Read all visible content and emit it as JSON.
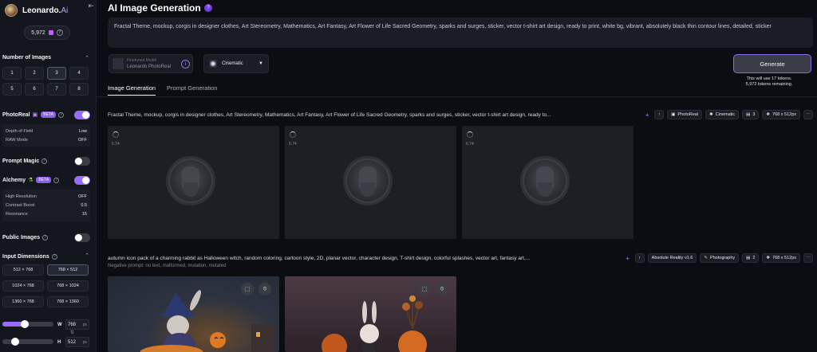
{
  "brand": {
    "name": "Leonardo.",
    "suffix": "Ai",
    "collapse_icon": "collapse-sidebar-icon"
  },
  "tokens": {
    "count": "5,972"
  },
  "sidebar": {
    "num_images_title": "Number of Images",
    "num_images": [
      "1",
      "2",
      "3",
      "4",
      "5",
      "6",
      "7",
      "8"
    ],
    "num_images_selected": "3",
    "photoreal": {
      "label": "PhotoReal",
      "badge": "BETA",
      "on": true,
      "rows": [
        {
          "k": "Depth of Field",
          "v": "Low"
        },
        {
          "k": "RAW Mode",
          "v": "OFF"
        }
      ]
    },
    "prompt_magic": {
      "label": "Prompt Magic",
      "on": false
    },
    "alchemy": {
      "label": "Alchemy",
      "badge": "BETA",
      "on": true,
      "rows": [
        {
          "k": "High Resolution",
          "v": "OFF"
        },
        {
          "k": "Contrast Boost",
          "v": "0.5"
        },
        {
          "k": "Resonance",
          "v": "15"
        }
      ]
    },
    "public_images": {
      "label": "Public Images",
      "on": false
    },
    "input_dimensions": {
      "title": "Input Dimensions",
      "options": [
        "512 × 768",
        "768 × 512",
        "1024 × 768",
        "768 × 1024",
        "1360 × 768",
        "768 × 1360"
      ],
      "selected": "768 × 512"
    },
    "width": {
      "label": "W",
      "value": "768",
      "unit": "px",
      "fraction": 0.42
    },
    "height": {
      "label": "H",
      "value": "512",
      "unit": "px",
      "fraction": 0.2
    }
  },
  "main": {
    "title": "AI Image Generation",
    "prompt": "Fractal Theme, mockup, corgis in designer clothes, Art Stereometry, Mathematics, Art Fantasy, Art Flower of Life Sacred Geometry, sparks and surges, sticker, vector t-shirt art design, ready to print, white bg, vibrant, absolutely black thin contour lines, detailed, sticker",
    "model": {
      "label": "Finetuned Model",
      "name": "Leonardo PhotoReal"
    },
    "style": {
      "name": "Cinematic"
    },
    "generate": {
      "label": "Generate",
      "note1": "This will use 17 tokens.",
      "note2": "5,972 tokens remaining."
    },
    "tabs": [
      "Image Generation",
      "Prompt Generation"
    ],
    "generations": [
      {
        "prompt": "Fractal Theme, mockup, corgis in designer clothes, Art Stereometry, Mathematics, Art Fantasy, Art Flower of Life Sacred Geometry, sparks and surges, sticker, vector t-shirt art design, ready to...",
        "tags": {
          "model": "PhotoReal",
          "style": "Cinematic",
          "count": "3",
          "size": "768 x 512px"
        },
        "placeholder_seconds": "6.74"
      },
      {
        "prompt": "autumn icon pack of a charming rabbit as Halloween witch, random coloring, cartoon style, 2D, planar vector, character design, T-shirt design, colorful splashes, vector art, fantasy art,...",
        "negative": "Negative prompt: no text, malformed, mutation, mutated",
        "tags": {
          "model": "Absolute Reality v1.6",
          "style": "Photography",
          "count": "2",
          "size": "768 x 512px"
        }
      }
    ]
  }
}
